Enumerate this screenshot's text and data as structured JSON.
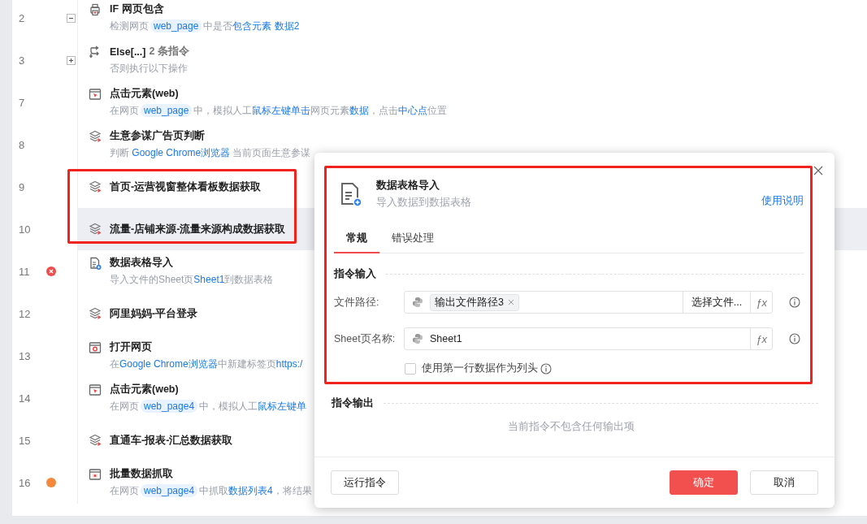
{
  "rows": [
    {
      "number": "2",
      "error": false,
      "breakpoint": false,
      "expanded": true,
      "kind": "condition",
      "title": "IF 网页包含",
      "selected": false,
      "framed": false,
      "description": [
        {
          "kind": "text",
          "text": "检测网页"
        },
        {
          "kind": "chip",
          "text": "web_page"
        },
        {
          "kind": "text",
          "text": "中是否"
        },
        {
          "kind": "link",
          "text": "包含元素 数据2"
        }
      ]
    },
    {
      "number": "3",
      "error": false,
      "breakpoint": false,
      "expanded": false,
      "kind": "branch",
      "title": "Else[...]",
      "title_note": "2 条指令",
      "selected": false,
      "framed": false,
      "description": [
        {
          "kind": "text",
          "text": "否则执行以下操作"
        }
      ]
    },
    {
      "number": "7",
      "error": false,
      "breakpoint": false,
      "kind": "click",
      "title": "点击元素(web)",
      "selected": false,
      "framed": false,
      "description": [
        {
          "kind": "text",
          "text": "在网页"
        },
        {
          "kind": "chip",
          "text": "web_page"
        },
        {
          "kind": "text",
          "text": "中，模拟人工"
        },
        {
          "kind": "link",
          "text": "鼠标左键单击"
        },
        {
          "kind": "text",
          "text": "网页元素"
        },
        {
          "kind": "link",
          "text": "数据"
        },
        {
          "kind": "text",
          "text": "，点击"
        },
        {
          "kind": "link",
          "text": "中心点"
        },
        {
          "kind": "text",
          "text": "位置"
        }
      ]
    },
    {
      "number": "8",
      "error": false,
      "breakpoint": false,
      "kind": "flow",
      "title": "生意参谋广告页判断",
      "selected": false,
      "framed": false,
      "description": [
        {
          "kind": "text",
          "text": "判断 "
        },
        {
          "kind": "link",
          "text": "Google Chrome浏览器"
        },
        {
          "kind": "text",
          "text": " 当前页面生意参谋"
        }
      ]
    },
    {
      "number": "9",
      "error": false,
      "breakpoint": false,
      "kind": "flow",
      "title": "首页-运营视窗整体看板数据获取",
      "selected": false,
      "framed": true
    },
    {
      "number": "10",
      "error": false,
      "breakpoint": false,
      "kind": "flow",
      "title": "流量-店铺来源-流量来源构成数据获取",
      "selected": true,
      "framed": true
    },
    {
      "number": "11",
      "error": true,
      "breakpoint": false,
      "kind": "import",
      "title": "数据表格导入",
      "selected": false,
      "framed": false,
      "description": [
        {
          "kind": "text",
          "text": "导入文件的Sheet页"
        },
        {
          "kind": "link",
          "text": "Sheet1"
        },
        {
          "kind": "text",
          "text": "到数据表格"
        }
      ]
    },
    {
      "number": "12",
      "error": false,
      "breakpoint": false,
      "kind": "flow",
      "title": "阿里妈妈-平台登录",
      "selected": false,
      "framed": false
    },
    {
      "number": "13",
      "error": false,
      "breakpoint": false,
      "kind": "browser",
      "title": "打开网页",
      "selected": false,
      "framed": false,
      "description": [
        {
          "kind": "text",
          "text": "在"
        },
        {
          "kind": "link",
          "text": "Google Chrome浏览器"
        },
        {
          "kind": "text",
          "text": "中新建标签页"
        },
        {
          "kind": "link",
          "text": "https:/"
        }
      ]
    },
    {
      "number": "14",
      "error": false,
      "breakpoint": false,
      "kind": "click",
      "title": "点击元素(web)",
      "selected": false,
      "framed": false,
      "description": [
        {
          "kind": "text",
          "text": "在网页"
        },
        {
          "kind": "chip",
          "text": "web_page4"
        },
        {
          "kind": "text",
          "text": "中，模拟人工"
        },
        {
          "kind": "link",
          "text": "鼠标左键单"
        }
      ]
    },
    {
      "number": "15",
      "error": false,
      "breakpoint": false,
      "kind": "flow",
      "title": "直通车-报表-汇总数据获取",
      "selected": false,
      "framed": false
    },
    {
      "number": "16",
      "error": false,
      "breakpoint": true,
      "kind": "scrape",
      "title": "批量数据抓取",
      "selected": false,
      "framed": false,
      "description": [
        {
          "kind": "text",
          "text": "在网页"
        },
        {
          "kind": "chip",
          "text": "web_page4"
        },
        {
          "kind": "text",
          "text": "中抓取"
        },
        {
          "kind": "link",
          "text": "数据列表4"
        },
        {
          "kind": "text",
          "text": "，将结果"
        }
      ]
    }
  ],
  "dialog": {
    "title": "数据表格导入",
    "subtitle": "导入数据到数据表格",
    "help_link": "使用说明",
    "framed": true,
    "tabs": [
      {
        "label": "常规",
        "selected": true
      },
      {
        "label": "错误处理",
        "selected": false
      }
    ],
    "input_section": "指令输入",
    "fields": [
      {
        "kind": "file",
        "label": "文件路径:",
        "token": "输出文件路径3",
        "button": "选择文件...",
        "formula": "ƒx"
      },
      {
        "kind": "text",
        "label": "Sheet页名称:",
        "value": "Sheet1",
        "formula": "ƒx"
      }
    ],
    "checkbox": {
      "label": "使用第一行数据作为列头",
      "checked": false
    },
    "output_section": "指令输出",
    "output_empty": "当前指令不包含任何输出项",
    "buttons": [
      {
        "kind": "secondary",
        "label": "运行指令"
      },
      {
        "kind": "primary",
        "label": "确定"
      },
      {
        "kind": "secondary",
        "label": "取消"
      }
    ]
  }
}
